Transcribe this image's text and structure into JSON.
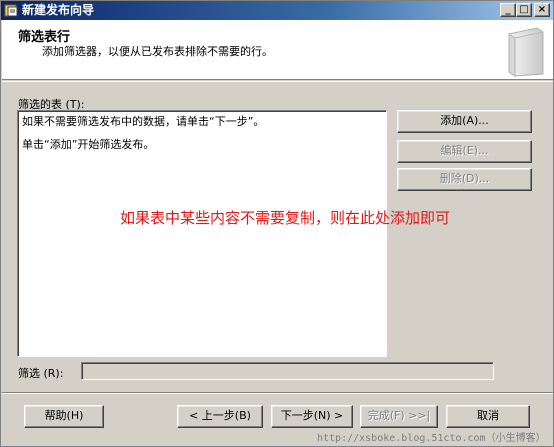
{
  "window": {
    "title": "新建发布向导",
    "controls": {
      "minimize": "_",
      "maximize": "□",
      "close": "×"
    }
  },
  "header": {
    "title": "筛选表行",
    "subtitle": "添加筛选器，以便从已发布表排除不需要的行。"
  },
  "tables": {
    "label": "筛选的表 (T):",
    "lines": [
      "如果不需要筛选发布中的数据，请单击“下一步”。",
      "单击“添加”开始筛选发布。"
    ]
  },
  "actions": {
    "add": "添加(A)...",
    "edit": "编辑(E)...",
    "delete": "删除(D)..."
  },
  "annotation": "如果表中某些内容不需要复制，则在此处添加即可",
  "filter": {
    "label": "筛选 (R):",
    "value": ""
  },
  "footer": {
    "help": "帮助(H)",
    "back": "< 上一步(B)",
    "next": "下一步(N) >",
    "finish": "完成(F) >>|",
    "cancel": "取消"
  },
  "watermark": "http://xsboke.blog.51cto.com（小生博客）",
  "colors": {
    "titlebar": "#0a246a",
    "annotation": "#e21818",
    "window": "#d4d0c8"
  }
}
